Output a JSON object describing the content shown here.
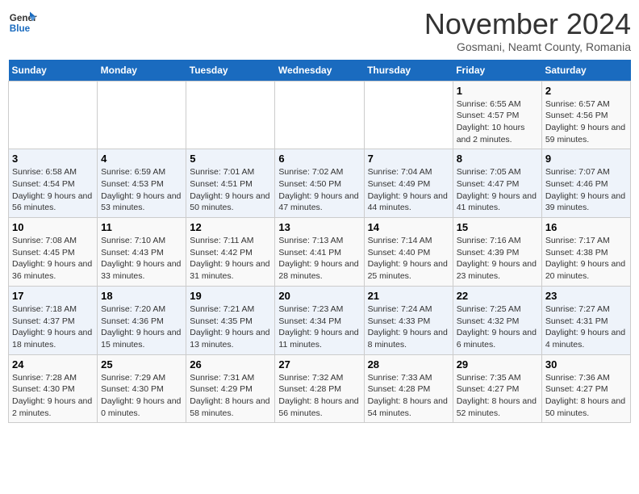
{
  "header": {
    "logo_line1": "General",
    "logo_line2": "Blue",
    "month": "November 2024",
    "location": "Gosmani, Neamt County, Romania"
  },
  "days_of_week": [
    "Sunday",
    "Monday",
    "Tuesday",
    "Wednesday",
    "Thursday",
    "Friday",
    "Saturday"
  ],
  "weeks": [
    [
      {
        "num": "",
        "info": ""
      },
      {
        "num": "",
        "info": ""
      },
      {
        "num": "",
        "info": ""
      },
      {
        "num": "",
        "info": ""
      },
      {
        "num": "",
        "info": ""
      },
      {
        "num": "1",
        "info": "Sunrise: 6:55 AM\nSunset: 4:57 PM\nDaylight: 10 hours and 2 minutes."
      },
      {
        "num": "2",
        "info": "Sunrise: 6:57 AM\nSunset: 4:56 PM\nDaylight: 9 hours and 59 minutes."
      }
    ],
    [
      {
        "num": "3",
        "info": "Sunrise: 6:58 AM\nSunset: 4:54 PM\nDaylight: 9 hours and 56 minutes."
      },
      {
        "num": "4",
        "info": "Sunrise: 6:59 AM\nSunset: 4:53 PM\nDaylight: 9 hours and 53 minutes."
      },
      {
        "num": "5",
        "info": "Sunrise: 7:01 AM\nSunset: 4:51 PM\nDaylight: 9 hours and 50 minutes."
      },
      {
        "num": "6",
        "info": "Sunrise: 7:02 AM\nSunset: 4:50 PM\nDaylight: 9 hours and 47 minutes."
      },
      {
        "num": "7",
        "info": "Sunrise: 7:04 AM\nSunset: 4:49 PM\nDaylight: 9 hours and 44 minutes."
      },
      {
        "num": "8",
        "info": "Sunrise: 7:05 AM\nSunset: 4:47 PM\nDaylight: 9 hours and 41 minutes."
      },
      {
        "num": "9",
        "info": "Sunrise: 7:07 AM\nSunset: 4:46 PM\nDaylight: 9 hours and 39 minutes."
      }
    ],
    [
      {
        "num": "10",
        "info": "Sunrise: 7:08 AM\nSunset: 4:45 PM\nDaylight: 9 hours and 36 minutes."
      },
      {
        "num": "11",
        "info": "Sunrise: 7:10 AM\nSunset: 4:43 PM\nDaylight: 9 hours and 33 minutes."
      },
      {
        "num": "12",
        "info": "Sunrise: 7:11 AM\nSunset: 4:42 PM\nDaylight: 9 hours and 31 minutes."
      },
      {
        "num": "13",
        "info": "Sunrise: 7:13 AM\nSunset: 4:41 PM\nDaylight: 9 hours and 28 minutes."
      },
      {
        "num": "14",
        "info": "Sunrise: 7:14 AM\nSunset: 4:40 PM\nDaylight: 9 hours and 25 minutes."
      },
      {
        "num": "15",
        "info": "Sunrise: 7:16 AM\nSunset: 4:39 PM\nDaylight: 9 hours and 23 minutes."
      },
      {
        "num": "16",
        "info": "Sunrise: 7:17 AM\nSunset: 4:38 PM\nDaylight: 9 hours and 20 minutes."
      }
    ],
    [
      {
        "num": "17",
        "info": "Sunrise: 7:18 AM\nSunset: 4:37 PM\nDaylight: 9 hours and 18 minutes."
      },
      {
        "num": "18",
        "info": "Sunrise: 7:20 AM\nSunset: 4:36 PM\nDaylight: 9 hours and 15 minutes."
      },
      {
        "num": "19",
        "info": "Sunrise: 7:21 AM\nSunset: 4:35 PM\nDaylight: 9 hours and 13 minutes."
      },
      {
        "num": "20",
        "info": "Sunrise: 7:23 AM\nSunset: 4:34 PM\nDaylight: 9 hours and 11 minutes."
      },
      {
        "num": "21",
        "info": "Sunrise: 7:24 AM\nSunset: 4:33 PM\nDaylight: 9 hours and 8 minutes."
      },
      {
        "num": "22",
        "info": "Sunrise: 7:25 AM\nSunset: 4:32 PM\nDaylight: 9 hours and 6 minutes."
      },
      {
        "num": "23",
        "info": "Sunrise: 7:27 AM\nSunset: 4:31 PM\nDaylight: 9 hours and 4 minutes."
      }
    ],
    [
      {
        "num": "24",
        "info": "Sunrise: 7:28 AM\nSunset: 4:30 PM\nDaylight: 9 hours and 2 minutes."
      },
      {
        "num": "25",
        "info": "Sunrise: 7:29 AM\nSunset: 4:30 PM\nDaylight: 9 hours and 0 minutes."
      },
      {
        "num": "26",
        "info": "Sunrise: 7:31 AM\nSunset: 4:29 PM\nDaylight: 8 hours and 58 minutes."
      },
      {
        "num": "27",
        "info": "Sunrise: 7:32 AM\nSunset: 4:28 PM\nDaylight: 8 hours and 56 minutes."
      },
      {
        "num": "28",
        "info": "Sunrise: 7:33 AM\nSunset: 4:28 PM\nDaylight: 8 hours and 54 minutes."
      },
      {
        "num": "29",
        "info": "Sunrise: 7:35 AM\nSunset: 4:27 PM\nDaylight: 8 hours and 52 minutes."
      },
      {
        "num": "30",
        "info": "Sunrise: 7:36 AM\nSunset: 4:27 PM\nDaylight: 8 hours and 50 minutes."
      }
    ]
  ]
}
